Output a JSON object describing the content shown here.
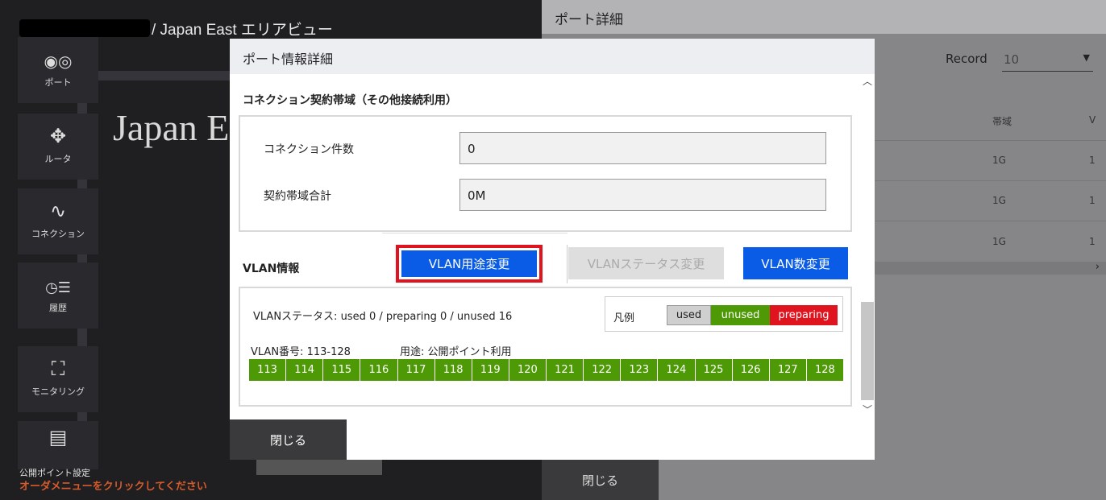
{
  "background": {
    "breadcrumb": "/ Japan East エリアビュー",
    "map_title": "Japan E",
    "nav": [
      {
        "label": "ポート",
        "icon": "port-icon",
        "glyph": "◉◎"
      },
      {
        "label": "ルータ",
        "icon": "router-icon",
        "glyph": "✥"
      },
      {
        "label": "コネクション",
        "icon": "connection-icon",
        "glyph": "∿"
      },
      {
        "label": "履歴",
        "icon": "history-icon",
        "glyph": "◷☰"
      },
      {
        "label": "モニタリング",
        "icon": "monitoring-icon",
        "glyph": "⛶"
      },
      {
        "label": "",
        "icon": "public-point-icon",
        "glyph": "▤"
      }
    ],
    "public_point_label": "公開ポイント設定",
    "order_warning": "オーダメニューをクリックしてください"
  },
  "right_panel": {
    "title": "ポート詳細",
    "record_label": "Record",
    "record_value": "10",
    "col_bandwidth": "帯域",
    "col_v": "V",
    "rows": [
      {
        "bandwidth": "1G",
        "v": "1"
      },
      {
        "bandwidth": "1G",
        "v": "1"
      },
      {
        "bandwidth": "1G",
        "v": "1"
      }
    ],
    "close_label": "閉じる"
  },
  "modal": {
    "title": "ポート情報詳細",
    "section_title": "コネクション契約帯域（その他接続利用）",
    "conn_count_label": "コネクション件数",
    "conn_count_value": "0",
    "bandwidth_total_label": "契約帯域合計",
    "bandwidth_total_value": "0M",
    "vlan_title": "VLAN情報",
    "vlan_use_button": "VLAN用途変更",
    "vlan_status_button": "VLANステータス変更",
    "vlan_num_button": "VLAN数変更",
    "vlan_status_text": "VLANステータス: used 0 / preparing 0 / unused 16",
    "legend": {
      "label": "凡例",
      "used": "used",
      "unused": "unused",
      "preparing": "preparing"
    },
    "vlan_number": "VLAN番号: 113-128",
    "vlan_purpose": "用途: 公開ポイント利用",
    "vlans": [
      "113",
      "114",
      "115",
      "116",
      "117",
      "118",
      "119",
      "120",
      "121",
      "122",
      "123",
      "124",
      "125",
      "126",
      "127",
      "128"
    ],
    "close_label": "閉じる"
  },
  "colors": {
    "accent_blue": "#0a5ce6",
    "highlight_red": "#e0141e",
    "unused_green": "#4e9a06",
    "used_gray": "#cfcfcf"
  }
}
